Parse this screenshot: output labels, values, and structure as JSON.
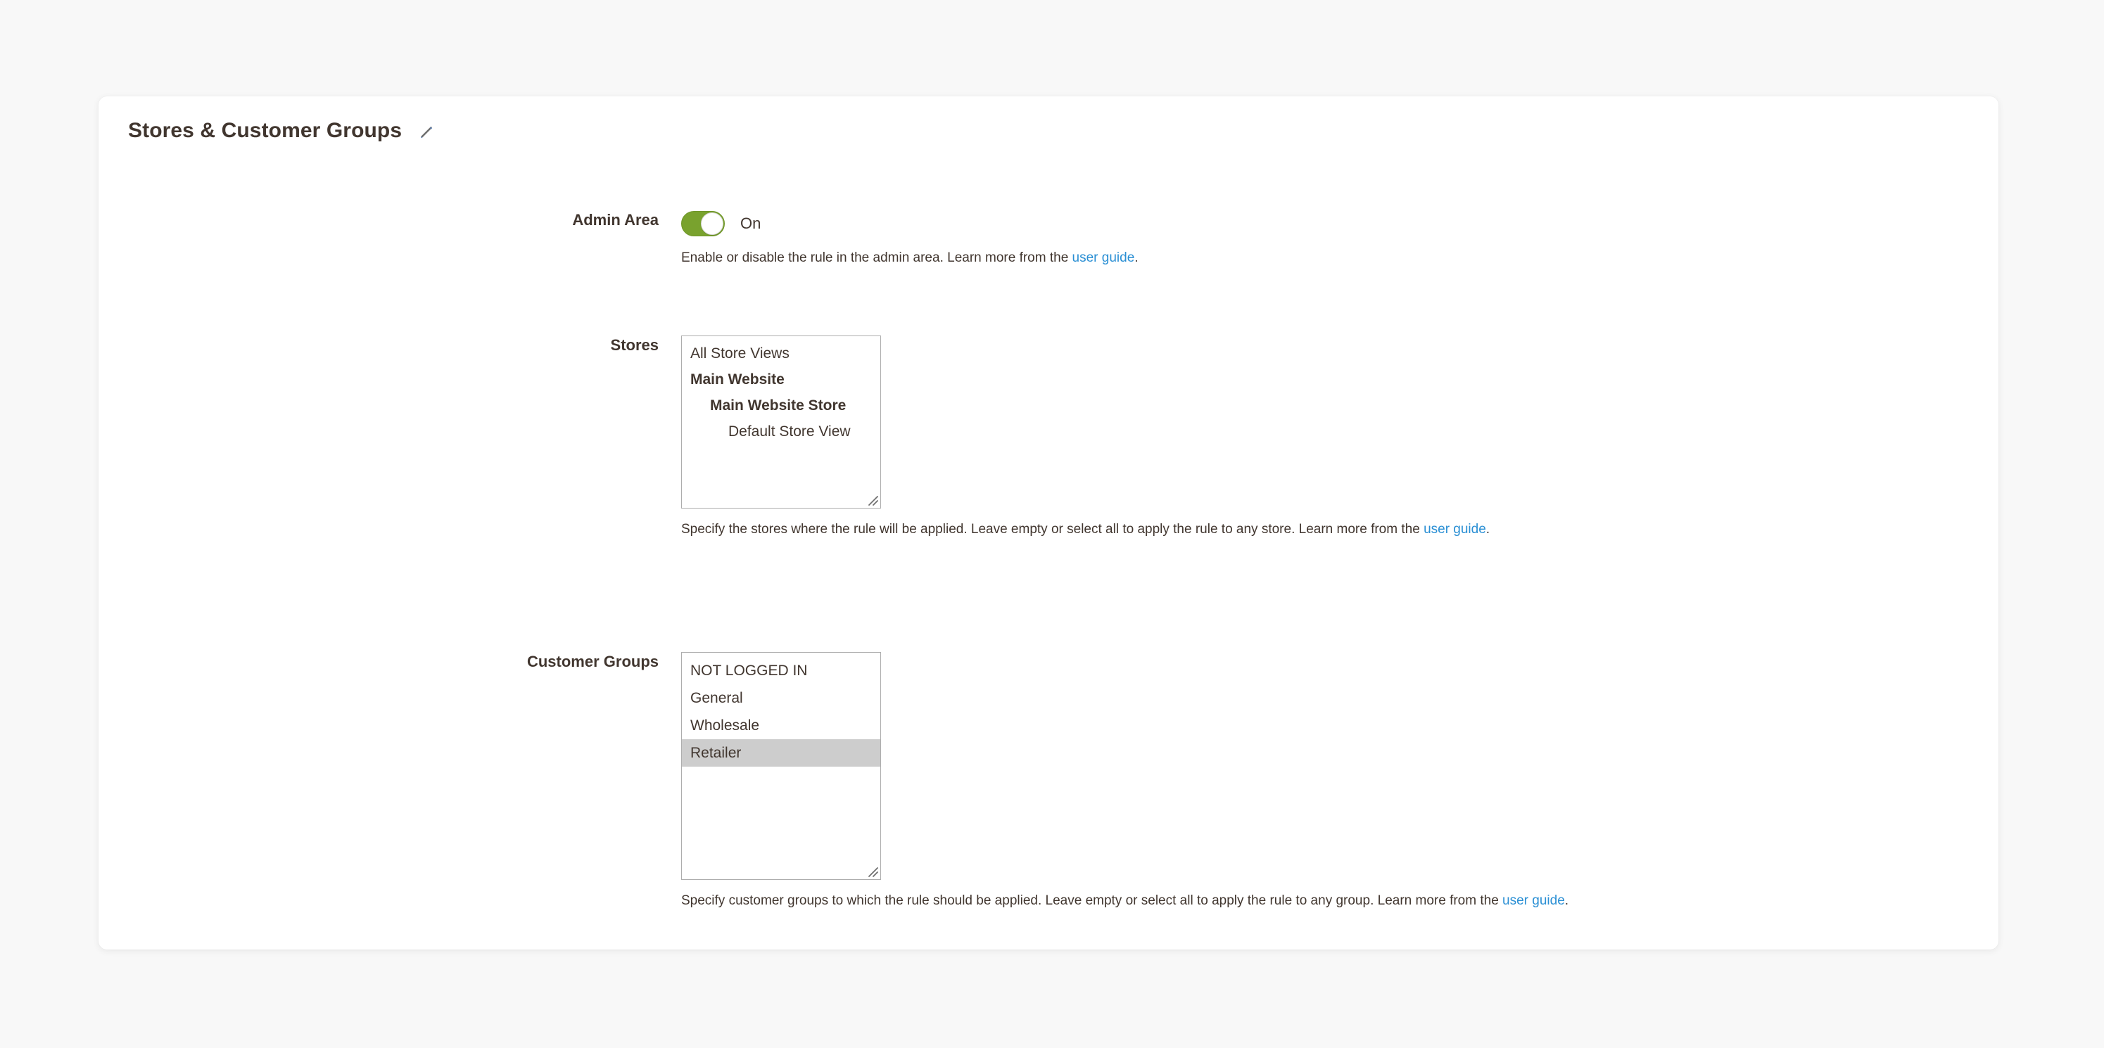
{
  "card": {
    "title": "Stores & Customer Groups",
    "edit_icon": "pencil-icon"
  },
  "fields": {
    "admin_area": {
      "label": "Admin Area",
      "toggle_state": "On",
      "toggle_on": true,
      "help_before": "Enable or disable the rule in the admin area. Learn more from the ",
      "help_link": "user guide",
      "help_after": "."
    },
    "stores": {
      "label": "Stores",
      "options": [
        {
          "text": "All Store Views",
          "level": 1,
          "selected": false
        },
        {
          "text": "Main Website",
          "level": 2,
          "selected": false
        },
        {
          "text": "Main Website Store",
          "level": 3,
          "selected": false
        },
        {
          "text": "Default Store View",
          "level": 4,
          "selected": false
        }
      ],
      "help_before": "Specify the stores where the rule will be applied. Leave empty or select all to apply the rule to any store. Learn more from the ",
      "help_link": "user guide",
      "help_after": "."
    },
    "customer_groups": {
      "label": "Customer Groups",
      "options": [
        {
          "text": "NOT LOGGED IN",
          "selected": false
        },
        {
          "text": "General",
          "selected": false
        },
        {
          "text": "Wholesale",
          "selected": false
        },
        {
          "text": "Retailer",
          "selected": true
        }
      ],
      "help_before": "Specify customer groups to which the rule should be applied. Leave empty or select all to apply the rule to any group. Learn more from the ",
      "help_link": "user guide",
      "help_after": "."
    }
  },
  "colors": {
    "toggle_on": "#79a22e",
    "link": "#2a8fd4",
    "text": "#41362f",
    "selected_option": "#cdcdcd",
    "page_background": "#f8f8f8",
    "card_background": "#ffffff",
    "select_border": "#adadad"
  }
}
